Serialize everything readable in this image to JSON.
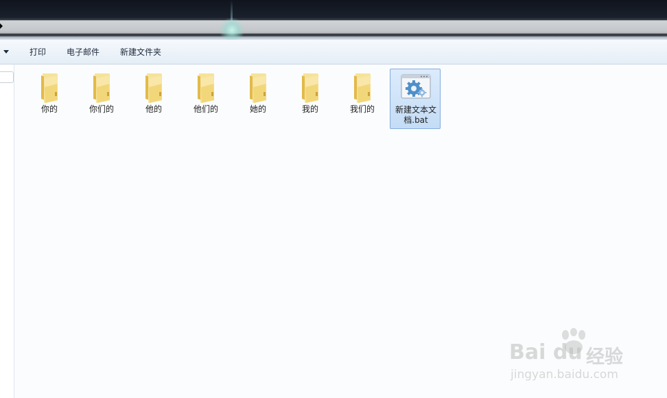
{
  "toolbar": {
    "items": [
      {
        "label": "打印"
      },
      {
        "label": "电子邮件"
      },
      {
        "label": "新建文件夹"
      }
    ]
  },
  "files": [
    {
      "name": "你的",
      "type": "folder"
    },
    {
      "name": "你们的",
      "type": "folder"
    },
    {
      "name": "他的",
      "type": "folder"
    },
    {
      "name": "他们的",
      "type": "folder"
    },
    {
      "name": "她的",
      "type": "folder"
    },
    {
      "name": "我的",
      "type": "folder"
    },
    {
      "name": "我们的",
      "type": "folder"
    },
    {
      "name": "新建文本文档.bat",
      "type": "batch-file",
      "selected": true
    }
  ],
  "watermark": {
    "brand_latin": "Bai du",
    "brand_cn": "经验",
    "url": "jingyan.baidu.com"
  },
  "colors": {
    "folder": "#f2d77a",
    "selection": "#cce0f7",
    "selection_border": "#84acdd"
  }
}
